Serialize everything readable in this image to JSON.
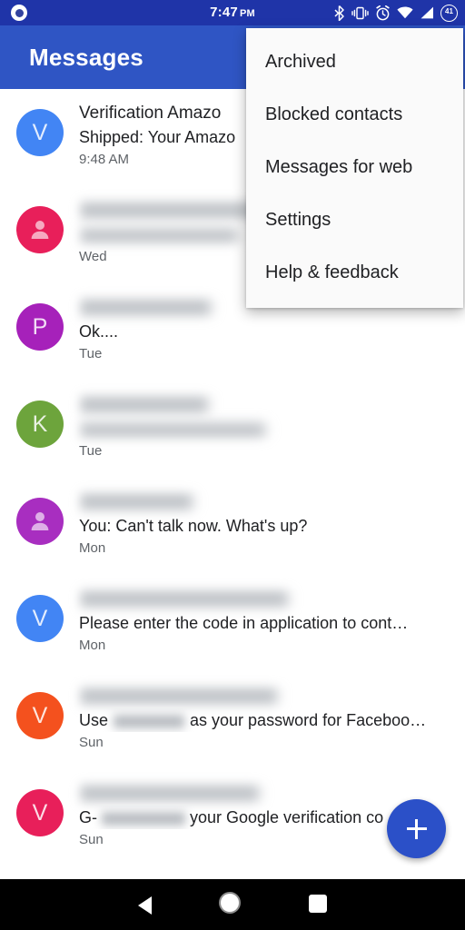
{
  "status_bar": {
    "time": "7:47",
    "am_pm": "PM",
    "battery_level": "41",
    "icons": [
      "camera-cutout",
      "bluetooth-icon",
      "vibrate-icon",
      "alarm-icon",
      "wifi-icon",
      "signal-icon",
      "battery-icon"
    ],
    "background_color": "#1f34a8"
  },
  "app_bar": {
    "title": "Messages",
    "background_color": "#2f55c4"
  },
  "overflow_menu": {
    "items": [
      {
        "label": "Archived"
      },
      {
        "label": "Blocked contacts"
      },
      {
        "label": "Messages for web"
      },
      {
        "label": "Settings"
      },
      {
        "label": "Help & feedback"
      }
    ]
  },
  "conversations": [
    {
      "avatar_letter": "V",
      "avatar_type": "letter",
      "avatar_color": "#4285f4",
      "title": "Verification Amazo",
      "title_blurred": false,
      "snippet": "Shipped: Your Amazo",
      "snippet_blurred": false,
      "time": "9:48 AM"
    },
    {
      "avatar_letter": "",
      "avatar_type": "person",
      "avatar_color": "#e81f5a",
      "title": "",
      "title_blurred": true,
      "snippet": "",
      "snippet_blurred": true,
      "time": "Wed"
    },
    {
      "avatar_letter": "P",
      "avatar_type": "letter",
      "avatar_color": "#a621ba",
      "title": "",
      "title_blurred": true,
      "snippet": "Ok....",
      "snippet_blurred": false,
      "time": "Tue"
    },
    {
      "avatar_letter": "K",
      "avatar_type": "letter",
      "avatar_color": "#6da43c",
      "title": "",
      "title_blurred": true,
      "snippet": "",
      "snippet_blurred": true,
      "time": "Tue"
    },
    {
      "avatar_letter": "",
      "avatar_type": "person",
      "avatar_color": "#a82ec0",
      "title": "",
      "title_blurred": true,
      "snippet": "You: Can't talk now. What's up?",
      "snippet_blurred": false,
      "time": "Mon"
    },
    {
      "avatar_letter": "V",
      "avatar_type": "letter",
      "avatar_color": "#4285f4",
      "title": "",
      "title_blurred": true,
      "snippet": "Please enter the code in application to cont…",
      "snippet_blurred": false,
      "time": "Mon"
    },
    {
      "avatar_letter": "V",
      "avatar_type": "letter",
      "avatar_color": "#f4511e",
      "title": "",
      "title_blurred": true,
      "snippet_prefix": "Use",
      "snippet_suffix": "as your password for Faceboo…",
      "snippet_blurred": false,
      "time": "Sun"
    },
    {
      "avatar_letter": "V",
      "avatar_type": "letter",
      "avatar_color": "#e81f5a",
      "title": "",
      "title_blurred": true,
      "snippet_prefix": "G-",
      "snippet_suffix": "your Google verification co",
      "snippet_blurred": false,
      "time": "Sun"
    }
  ],
  "fab": {
    "icon": "plus-icon",
    "color": "#2b50c8"
  },
  "nav_bar": {
    "buttons": [
      "back-icon",
      "home-icon",
      "recents-icon"
    ],
    "background_color": "#000000"
  }
}
